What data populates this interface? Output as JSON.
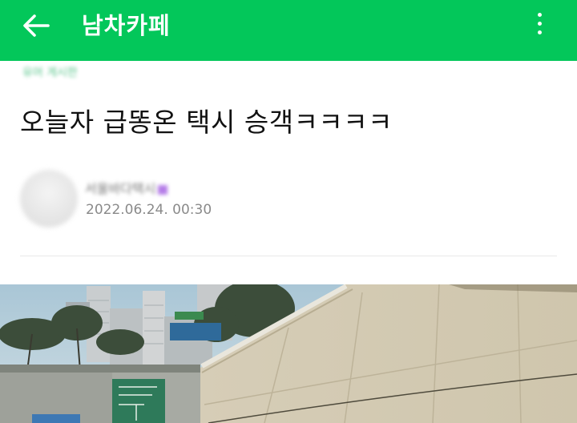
{
  "appbar": {
    "title": "남차카페",
    "back_icon": "arrow-left-icon",
    "more_icon": "more-vertical-icon",
    "color": "#03c75a"
  },
  "post": {
    "board_name": "유머 게시판",
    "title": "오늘자 급똥온 택시 승객ㅋㅋㅋㅋ",
    "author": {
      "nickname": "서울바다택시",
      "date": "2022.06.24. 00:30"
    },
    "image_description": "photo"
  }
}
